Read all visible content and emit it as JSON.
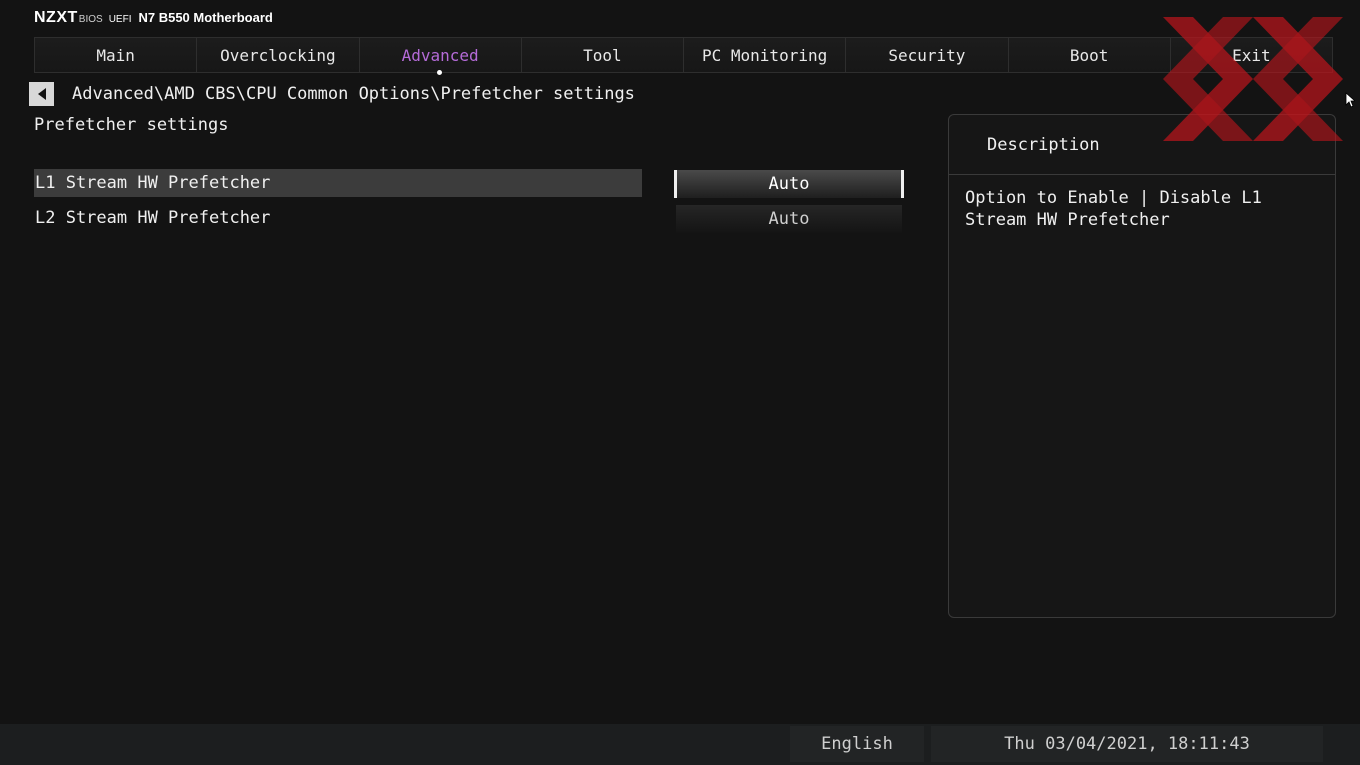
{
  "brand": {
    "logo": "NZXT",
    "bios": "BIOS",
    "uefi": "UEFI",
    "model": "N7 B550 Motherboard"
  },
  "tabs": [
    {
      "label": "Main",
      "active": false
    },
    {
      "label": "Overclocking",
      "active": false
    },
    {
      "label": "Advanced",
      "active": true
    },
    {
      "label": "Tool",
      "active": false
    },
    {
      "label": "PC Monitoring",
      "active": false
    },
    {
      "label": "Security",
      "active": false
    },
    {
      "label": "Boot",
      "active": false
    },
    {
      "label": "Exit",
      "active": false
    }
  ],
  "breadcrumb": "Advanced\\AMD CBS\\CPU Common Options\\Prefetcher settings",
  "page_title": "Prefetcher settings",
  "settings": [
    {
      "label": "L1 Stream HW Prefetcher",
      "value": "Auto",
      "selected": true
    },
    {
      "label": "L2 Stream HW Prefetcher",
      "value": "Auto",
      "selected": false
    }
  ],
  "description": {
    "header": "Description",
    "text": "Option to Enable | Disable L1 Stream HW Prefetcher"
  },
  "footer": {
    "language": "English",
    "datetime": "Thu 03/04/2021, 18:11:43"
  },
  "colors": {
    "accent": "#b56bd8",
    "watermark": "#c0151c",
    "background": "#131313"
  },
  "icons": {
    "back": "back-arrow-icon",
    "watermark": "watermark-logo-icon",
    "cursor": "mouse-cursor-icon"
  }
}
